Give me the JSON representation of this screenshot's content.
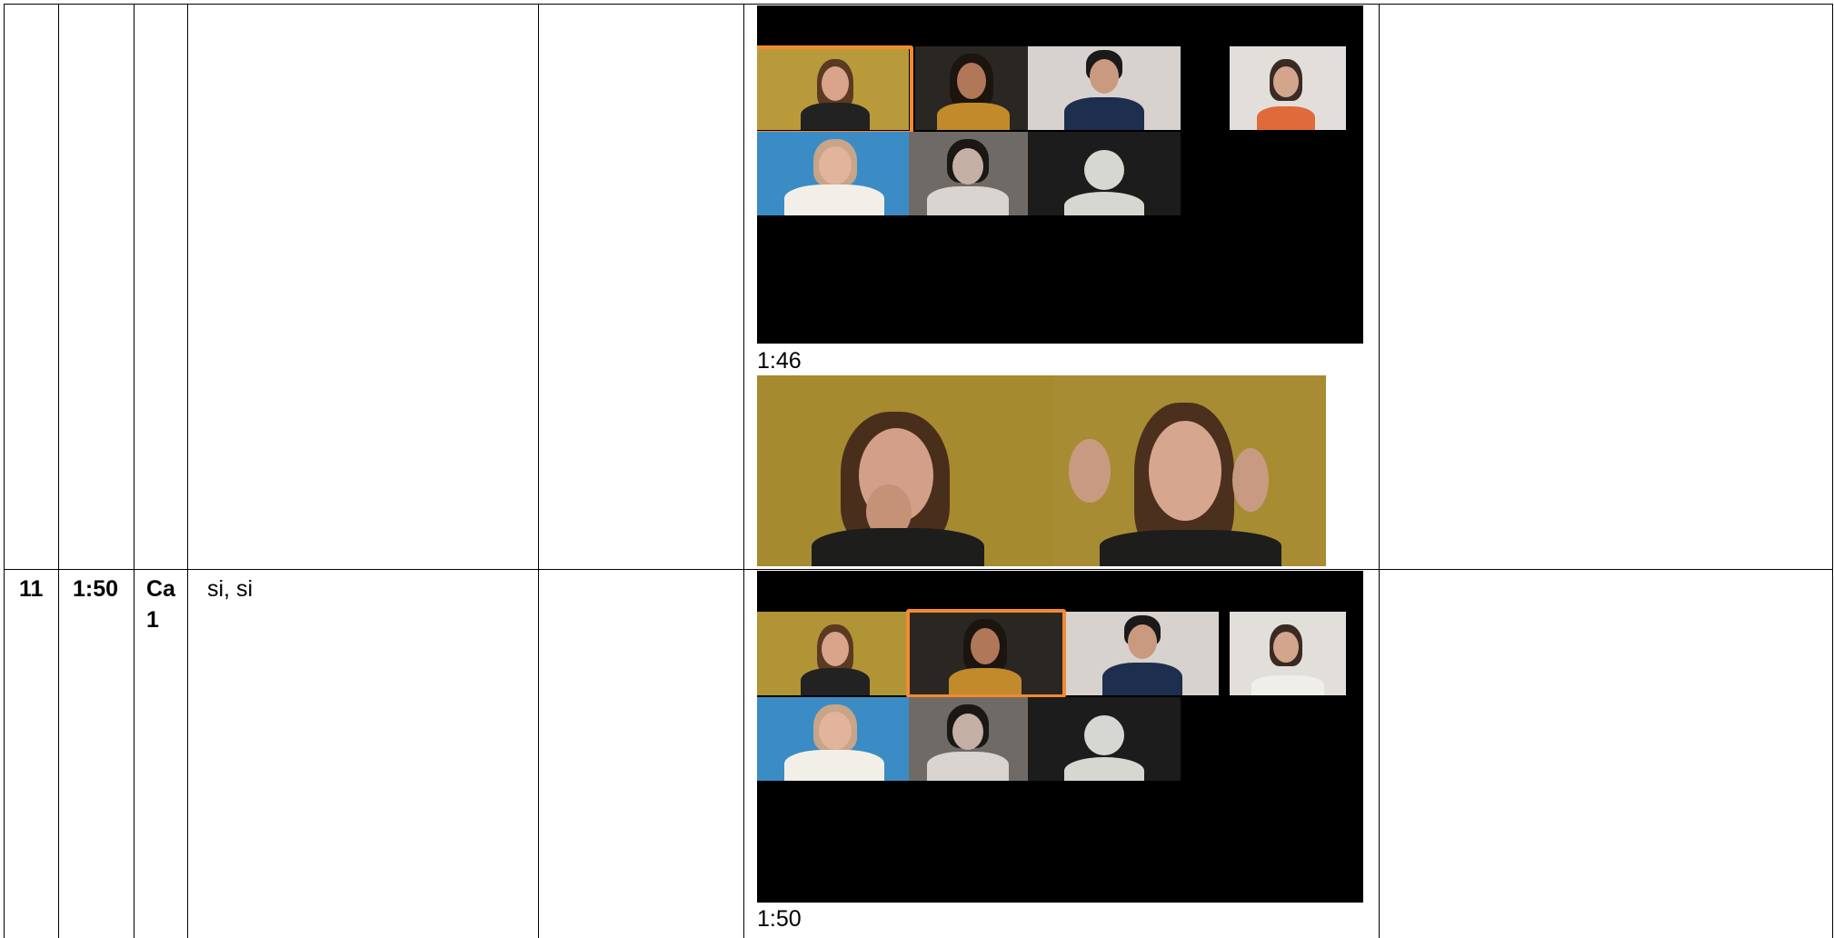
{
  "rows": [
    {
      "number": "",
      "time": "",
      "speaker": "",
      "utterance": "",
      "screenshots": [
        {
          "caption": "1:46",
          "highlighted_participant": 1
        },
        {
          "caption": "",
          "type": "two-frame-closeup"
        }
      ]
    },
    {
      "number": "11",
      "time": "1:50",
      "speaker": "Ca 1",
      "utterance": "si, si",
      "screenshots": [
        {
          "caption": "1:50",
          "highlighted_participant": 2
        }
      ]
    }
  ],
  "colors": {
    "highlight": "#f28a30",
    "video_background": "#000000",
    "grid_lines": "#000000"
  }
}
